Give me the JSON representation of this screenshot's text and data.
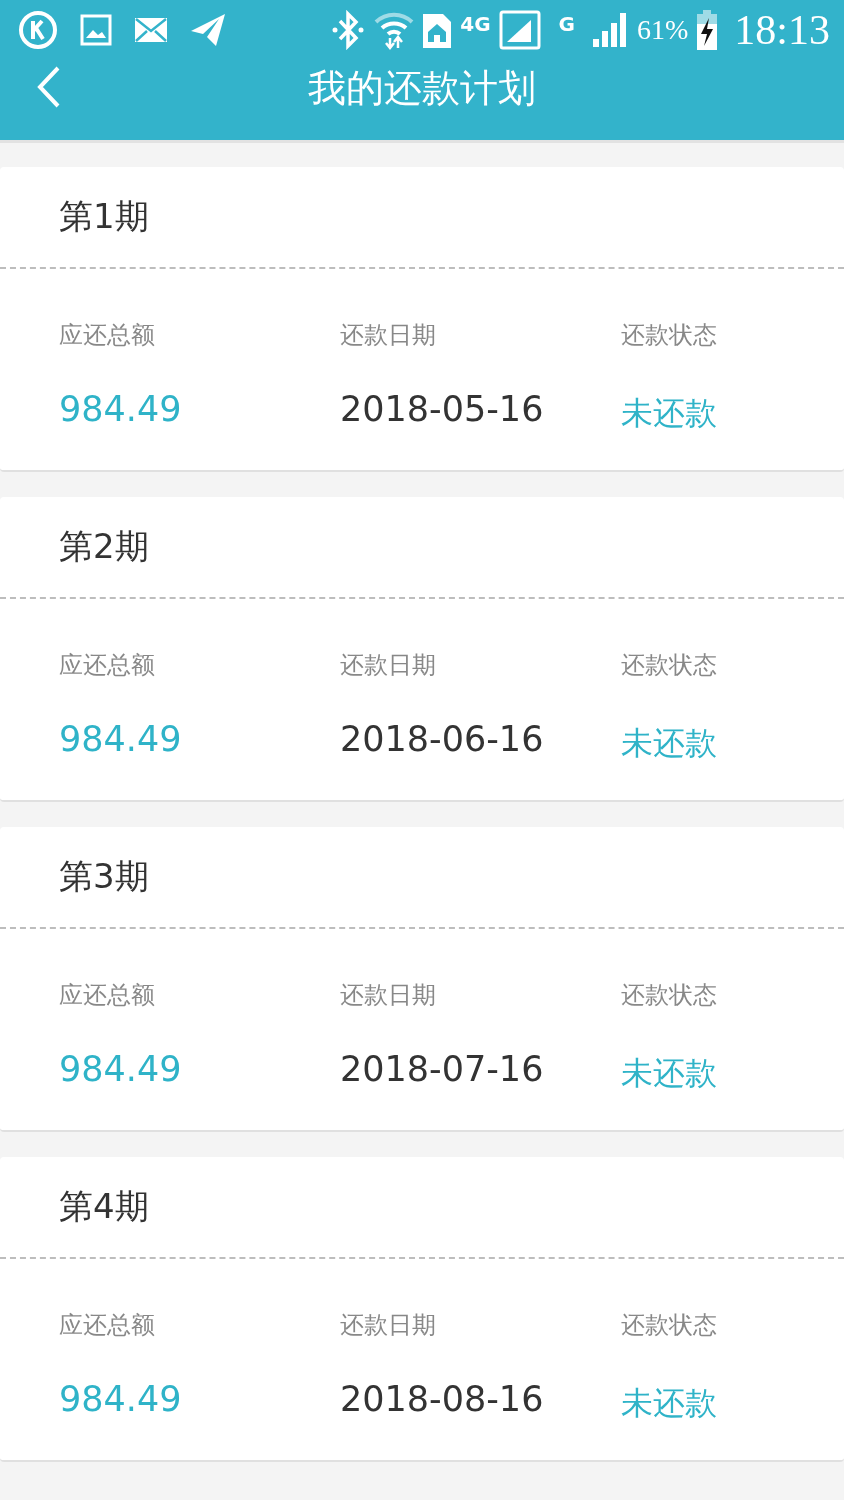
{
  "status_bar": {
    "network_4g": "4G",
    "network_g": "G",
    "battery": "61%",
    "time": "18:13"
  },
  "header": {
    "title": "我的还款计划"
  },
  "plans": [
    {
      "title": "第1期",
      "amount_label": "应还总额",
      "amount": "984.49",
      "date_label": "还款日期",
      "date": "2018-05-16",
      "status_label": "还款状态",
      "status": "未还款"
    },
    {
      "title": "第2期",
      "amount_label": "应还总额",
      "amount": "984.49",
      "date_label": "还款日期",
      "date": "2018-06-16",
      "status_label": "还款状态",
      "status": "未还款"
    },
    {
      "title": "第3期",
      "amount_label": "应还总额",
      "amount": "984.49",
      "date_label": "还款日期",
      "date": "2018-07-16",
      "status_label": "还款状态",
      "status": "未还款"
    },
    {
      "title": "第4期",
      "amount_label": "应还总额",
      "amount": "984.49",
      "date_label": "还款日期",
      "date": "2018-08-16",
      "status_label": "还款状态",
      "status": "未还款"
    }
  ]
}
